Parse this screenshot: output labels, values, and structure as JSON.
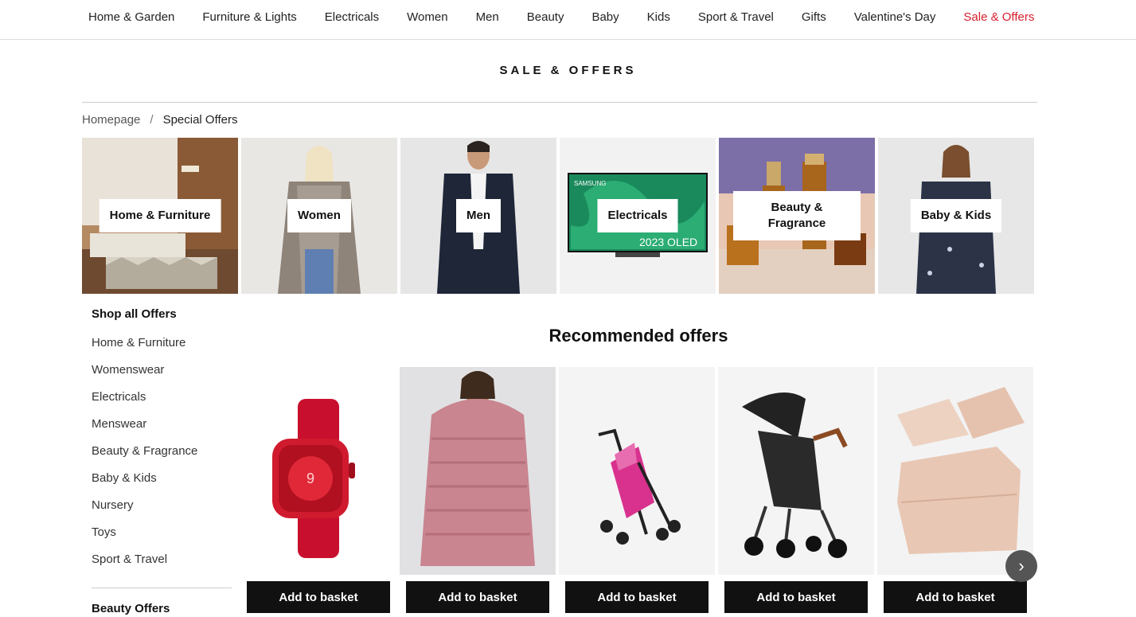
{
  "nav": {
    "items": [
      "Home & Garden",
      "Furniture & Lights",
      "Electricals",
      "Women",
      "Men",
      "Beauty",
      "Baby",
      "Kids",
      "Sport & Travel",
      "Gifts",
      "Valentine's Day",
      "Sale & Offers"
    ]
  },
  "page_title": "SALE & OFFERS",
  "breadcrumb": {
    "home": "Homepage",
    "separator": "/",
    "current": "Special Offers"
  },
  "tiles": [
    {
      "label": "Home & Furniture"
    },
    {
      "label": "Women"
    },
    {
      "label": "Men"
    },
    {
      "label": "Electricals",
      "tv_brand": "SAMSUNG",
      "tv_caption": "2023 OLED"
    },
    {
      "label": "Beauty & Fragrance"
    },
    {
      "label": "Baby & Kids"
    }
  ],
  "sidebar": {
    "heading": "Shop all Offers",
    "items": [
      "Home & Furniture",
      "Womenswear",
      "Electricals",
      "Menswear",
      "Beauty & Fragrance",
      "Baby & Kids",
      "Nursery",
      "Toys",
      "Sport & Travel"
    ],
    "heading2": "Beauty Offers"
  },
  "recommended": {
    "title": "Recommended offers",
    "button_label": "Add to basket",
    "products": [
      {
        "icon": "smartwatch-image"
      },
      {
        "icon": "hoodie-blanket-image"
      },
      {
        "icon": "stroller-pink-image"
      },
      {
        "icon": "stroller-black-image"
      },
      {
        "icon": "bedding-set-image"
      }
    ]
  },
  "colors": {
    "sale_red": "#d6202e",
    "button_black": "#111111"
  }
}
